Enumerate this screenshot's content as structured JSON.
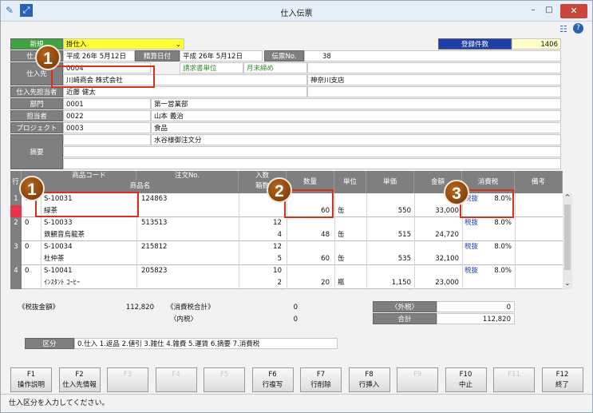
{
  "window": {
    "title": "仕入伝票",
    "min": "–",
    "max": "□",
    "close": "✕"
  },
  "header": {
    "mode": "新規",
    "type": "掛仕入",
    "count_label": "登録件数",
    "count": "1406",
    "date_label": "仕入日",
    "date": "平成 26年 5月12日",
    "settle_label": "精算日付",
    "settle_date": "平成 26年 5月12日",
    "slip_label": "伝票No.",
    "slip_no": "38",
    "supplier_label": "仕入先",
    "supplier_code": "0004",
    "supplier_name": "川崎商会 株式会社",
    "invoice_unit": "請求書単位",
    "closing": "月末締め",
    "branch": "神奈川支店",
    "contact_label": "仕入先担当者",
    "contact": "近藤 健太",
    "dept_label": "部門",
    "dept_code": "0001",
    "dept_name": "第一営業部",
    "staff_label": "担当者",
    "staff_code": "0022",
    "staff_name": "山本 義治",
    "project_label": "プロジェクト",
    "project_code": "0003",
    "project_name": "食品",
    "memo_label": "摘要",
    "memo": "水谷様御注文分"
  },
  "grid": {
    "headers": {
      "row": "行",
      "code": "商品コード",
      "name": "商品名",
      "order": "注文No.",
      "qty_top": "入数",
      "qty_bottom": "箱数",
      "qty": "数量",
      "unit": "単位",
      "price": "単価",
      "amount": "金額",
      "tax": "消費税",
      "remarks": "備考"
    },
    "rows": [
      {
        "no": "1",
        "kind": "0",
        "code": "S-10031",
        "name": "緑茶",
        "order": "124863",
        "per_box": "",
        "boxes": "",
        "qty": "60",
        "unit": "缶",
        "price": "550",
        "amount": "33,000",
        "tax_type": "税抜",
        "tax_rate": "8.0%"
      },
      {
        "no": "2",
        "kind": "0",
        "code": "S-10033",
        "name": "鉄観音烏龍茶",
        "order": "513513",
        "per_box": "12",
        "boxes": "4",
        "qty": "48",
        "unit": "缶",
        "price": "515",
        "amount": "24,720",
        "tax_type": "税抜",
        "tax_rate": "8.0%"
      },
      {
        "no": "3",
        "kind": "0",
        "code": "S-10034",
        "name": "杜仲茶",
        "order": "215812",
        "per_box": "12",
        "boxes": "5",
        "qty": "60",
        "unit": "缶",
        "price": "535",
        "amount": "32,100",
        "tax_type": "税抜",
        "tax_rate": "8.0%"
      },
      {
        "no": "4",
        "kind": "0",
        "code": "S-10041",
        "name": "ｲﾝｽﾀﾝﾄ ｺｰﾋｰ",
        "order": "205823",
        "per_box": "10",
        "boxes": "2",
        "qty": "20",
        "unit": "瓶",
        "price": "1,150",
        "amount": "23,000",
        "tax_type": "税抜",
        "tax_rate": "8.0%"
      }
    ]
  },
  "summary": {
    "excl_label": "《税抜金額》",
    "excl": "112,820",
    "tax_total_label": "《消費税合計》",
    "tax_total": "0",
    "incl_label": "〈内税〉",
    "incl": "0",
    "outer_label": "〈外税〉",
    "outer": "0",
    "total_label": "合計",
    "total": "112,820"
  },
  "division": {
    "label": "区分",
    "options": "0.仕入 1.返品 2.値引 3.雑仕 4.雑費 5.運賃 6.摘要 7.消費税"
  },
  "fkeys": [
    {
      "key": "F1",
      "label": "操作説明",
      "enabled": true
    },
    {
      "key": "F2",
      "label": "仕入先情報",
      "enabled": true
    },
    {
      "key": "F3",
      "label": "",
      "enabled": false
    },
    {
      "key": "F4",
      "label": "",
      "enabled": false
    },
    {
      "key": "F5",
      "label": "",
      "enabled": false
    },
    {
      "key": "F6",
      "label": "行複写",
      "enabled": true
    },
    {
      "key": "F7",
      "label": "行削除",
      "enabled": true
    },
    {
      "key": "F8",
      "label": "行挿入",
      "enabled": true
    },
    {
      "key": "F9",
      "label": "",
      "enabled": false
    },
    {
      "key": "F10",
      "label": "中止",
      "enabled": true
    },
    {
      "key": "F11",
      "label": "",
      "enabled": false
    },
    {
      "key": "F12",
      "label": "終了",
      "enabled": true
    }
  ],
  "status": "仕入区分を入力してください。",
  "callouts": [
    "1",
    "1",
    "2",
    "3"
  ]
}
